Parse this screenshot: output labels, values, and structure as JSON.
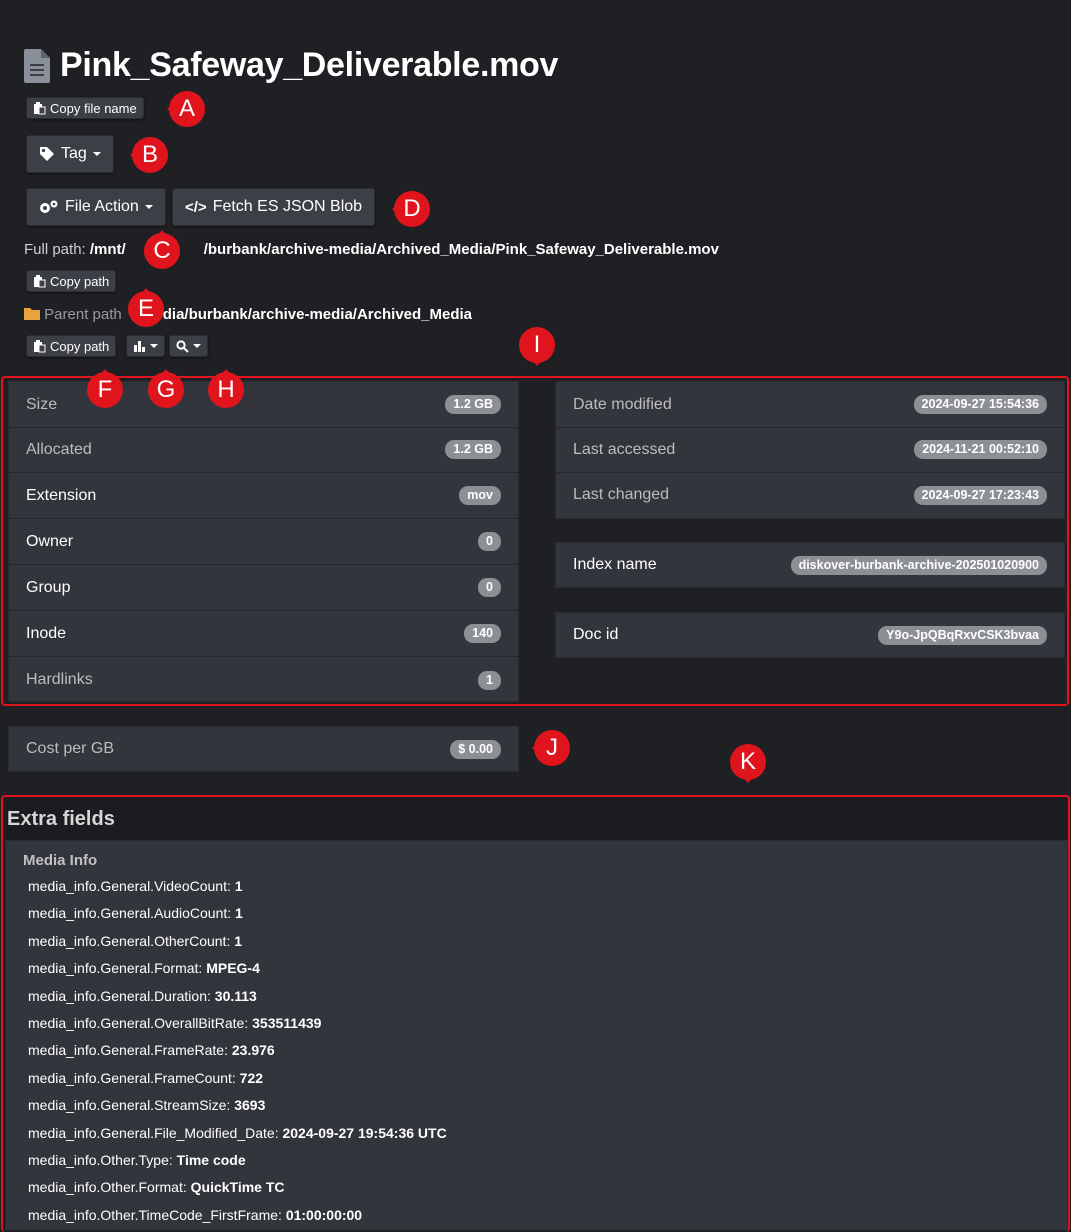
{
  "file": {
    "name": "Pink_Safeway_Deliverable.mov",
    "copy_name_label": "Copy file name",
    "tag_label": "Tag",
    "file_action_label": "File Action",
    "fetch_json_label": "Fetch ES JSON Blob",
    "full_path_label": "Full path:",
    "full_path_start": "/mnt/",
    "full_path_end": "/burbank/archive-media/Archived_Media/Pink_Safeway_Deliverable.mov",
    "copy_path_label": "Copy path",
    "parent_path_label": "Parent path",
    "parent_path_value": "t/media/burbank/archive-media/Archived_Media",
    "copy_parent_label": "Copy path"
  },
  "stats_left": [
    {
      "label": "Size",
      "value": "1.2 GB"
    },
    {
      "label": "Allocated",
      "value": "1.2 GB"
    },
    {
      "label": "Extension",
      "value": "mov"
    },
    {
      "label": "Owner",
      "value": "0"
    },
    {
      "label": "Group",
      "value": "0"
    },
    {
      "label": "Inode",
      "value": "140"
    },
    {
      "label": "Hardlinks",
      "value": "1"
    }
  ],
  "stats_right": [
    {
      "label": "Date modified",
      "value": "2024-09-27 15:54:36"
    },
    {
      "label": "Last accessed",
      "value": "2024-11-21 00:52:10"
    },
    {
      "label": "Last changed",
      "value": "2024-09-27 17:23:43"
    }
  ],
  "index": {
    "label": "Index name",
    "value": "diskover-burbank-archive-202501020900"
  },
  "doc": {
    "label": "Doc id",
    "value": "Y9o-JpQBqRxvCSK3bvaa"
  },
  "cost": {
    "label": "Cost per GB",
    "value": "$ 0.00"
  },
  "extra": {
    "title": "Extra fields",
    "section": "Media Info",
    "fields": [
      {
        "key": "media_info.General.VideoCount:",
        "value": "1"
      },
      {
        "key": "media_info.General.AudioCount:",
        "value": "1"
      },
      {
        "key": "media_info.General.OtherCount:",
        "value": "1"
      },
      {
        "key": "media_info.General.Format:",
        "value": "MPEG-4"
      },
      {
        "key": "media_info.General.Duration:",
        "value": "30.113"
      },
      {
        "key": "media_info.General.OverallBitRate:",
        "value": "353511439"
      },
      {
        "key": "media_info.General.FrameRate:",
        "value": "23.976"
      },
      {
        "key": "media_info.General.FrameCount:",
        "value": "722"
      },
      {
        "key": "media_info.General.StreamSize:",
        "value": "3693"
      },
      {
        "key": "media_info.General.File_Modified_Date:",
        "value": "2024-09-27 19:54:36 UTC"
      },
      {
        "key": "media_info.Other.Type:",
        "value": "Time code"
      },
      {
        "key": "media_info.Other.Format:",
        "value": "QuickTime TC"
      },
      {
        "key": "media_info.Other.TimeCode_FirstFrame:",
        "value": "01:00:00:00"
      }
    ]
  },
  "markers": [
    "A",
    "B",
    "C",
    "D",
    "E",
    "F",
    "G",
    "H",
    "I",
    "J",
    "K"
  ],
  "colors": {
    "marker": "#e0141c",
    "background": "#1f2024",
    "panel": "#32353b",
    "badge": "#8c8f94"
  }
}
